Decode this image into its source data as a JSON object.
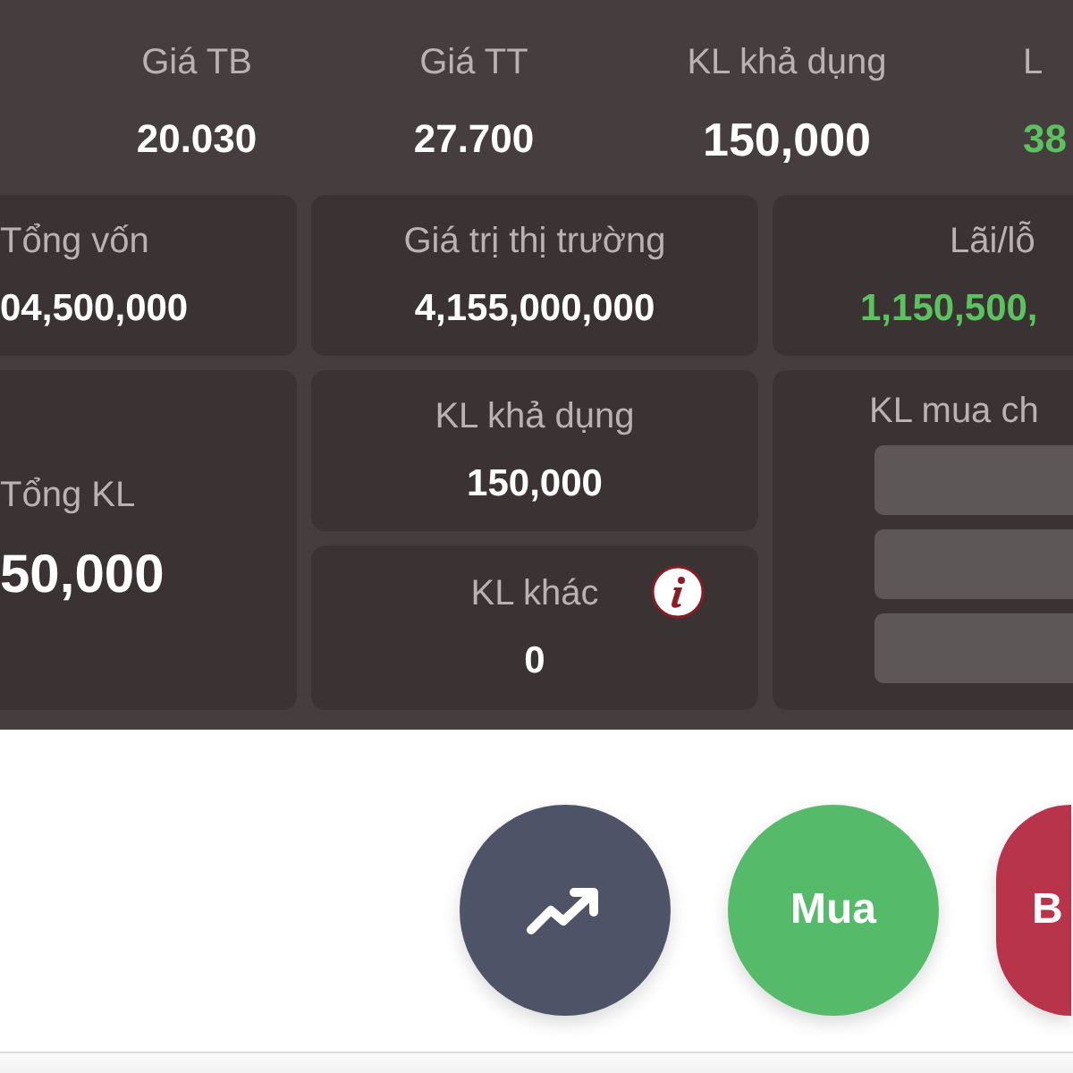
{
  "summary": [
    {
      "label": "Giá TB",
      "value": "20.030",
      "color": "#ffffff"
    },
    {
      "label": "Giá TT",
      "value": "27.700",
      "color": "#ffffff"
    },
    {
      "label": "KL khả dụng",
      "value": "150,000",
      "color": "#ffffff"
    },
    {
      "label": "L",
      "value": "38",
      "color": "#5cc260"
    }
  ],
  "total_capital": {
    "label": "Tổng vốn",
    "value": "04,500,000",
    "color": "#ffffff"
  },
  "market_value": {
    "label": "Giá trị thị trường",
    "value": "4,155,000,000",
    "color": "#ffffff"
  },
  "profit_loss": {
    "label": "Lãi/lỗ",
    "value": "1,150,500,",
    "color": "#5cc260"
  },
  "total_volume": {
    "label": "Tổng KL",
    "value": "50,000"
  },
  "available_volume": {
    "label": "KL khả dụng",
    "value": "150,000"
  },
  "other_volume": {
    "label": "KL khác",
    "value": "0",
    "info": true
  },
  "pending_buy": {
    "label": "KL mua ch"
  },
  "actions": [
    {
      "kind": "trend"
    },
    {
      "kind": "buy",
      "label": "Mua"
    },
    {
      "kind": "sell",
      "label": "B"
    }
  ]
}
